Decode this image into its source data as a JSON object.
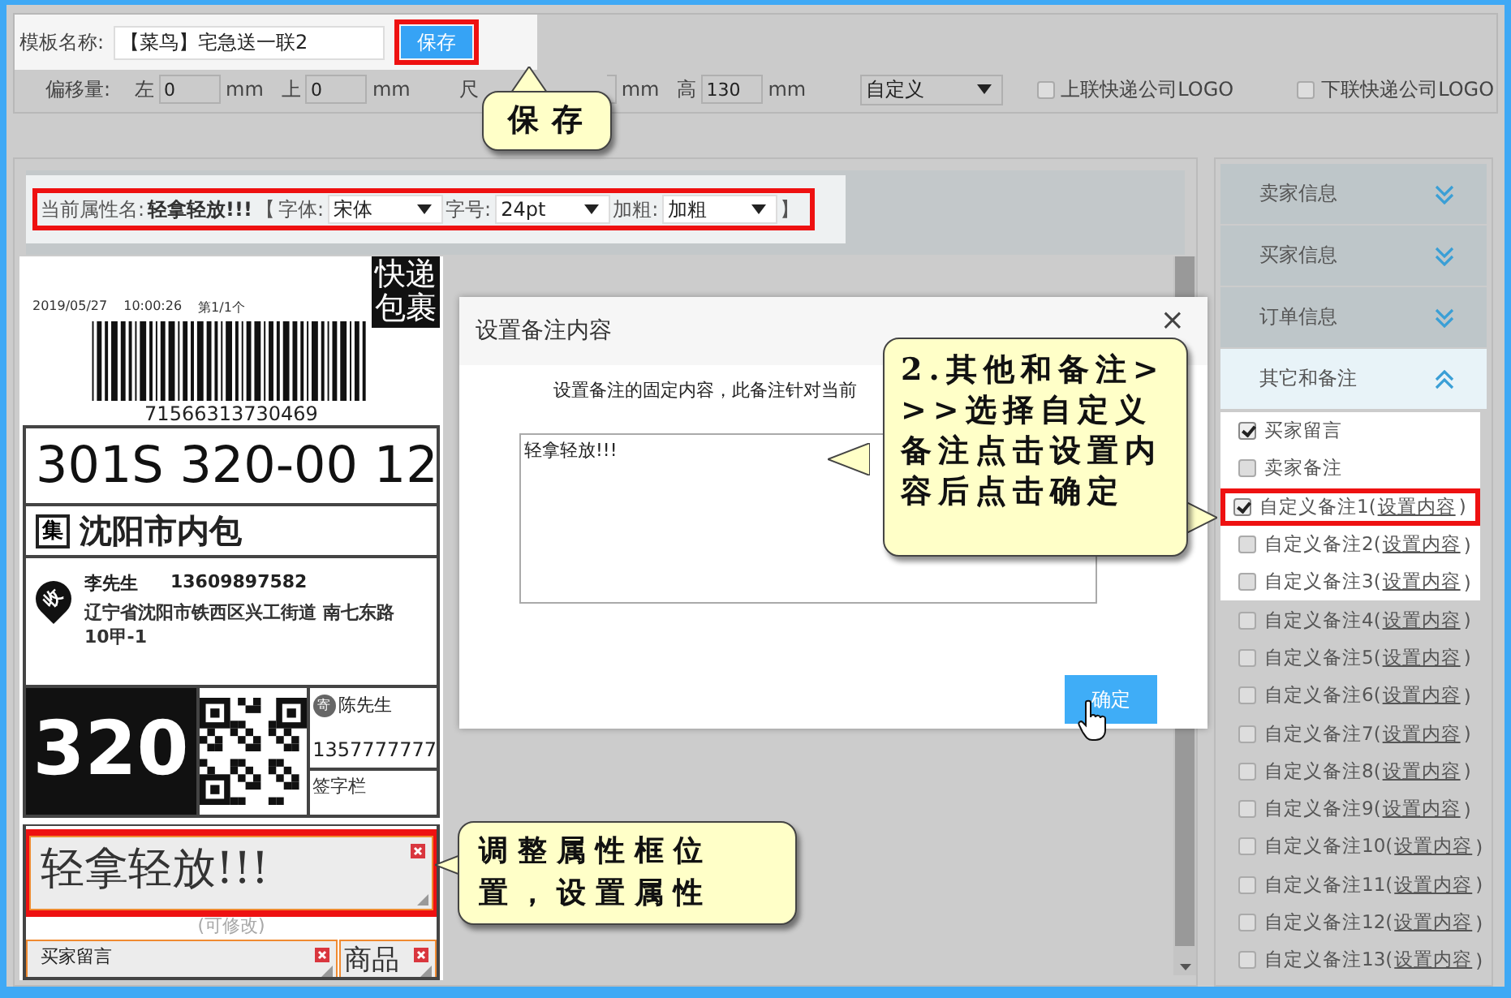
{
  "top_bar": {
    "name_label": "模板名称:",
    "name_value": "【菜鸟】宅急送一联2",
    "save_button": {
      "label": "保存",
      "highlighted": true
    },
    "offset_label": "偏移量:",
    "left_label": "左",
    "left_value": "0",
    "left_unit": "mm",
    "top_label": "上",
    "top_value": "0",
    "top_unit": "mm",
    "size_label": "尺",
    "size_unit": "mm",
    "height_label": "高",
    "height_value": "130",
    "height_unit": "mm",
    "size_preset": "自定义",
    "logo_options": [
      {
        "label": "上联快递公司LOGO",
        "checked": false
      },
      {
        "label": "下联快递公司LOGO",
        "checked": false
      }
    ]
  },
  "property_bar": {
    "highlighted": true,
    "name_label": "当前属性名:",
    "name_value": "轻拿轻放!!!",
    "open_bracket": "【",
    "font_label": "字体:",
    "font_value": "宋体",
    "size_label": "字号:",
    "size_value": "24pt",
    "bold_label": "加粗:",
    "bold_value": "加粗",
    "close_bracket": "】"
  },
  "label_preview": {
    "date": "2019/05/27",
    "time": "10:00:26",
    "page": "第1/1个",
    "badge": "快递包裹",
    "tracking_number": "71566313730469",
    "sort_code": "301S 320-00 12",
    "hub_mark": "集",
    "hub": "沈阳市内包",
    "recipient_mark": "收",
    "recipient_name": "李先生",
    "recipient_phone": "13609897582",
    "recipient_address": "辽宁省沈阳市铁西区兴工街道 南七东路10甲-1",
    "route_code": "320",
    "sender_mark": "寄",
    "sender_name": "陈先生",
    "sender_phone": "1357777777",
    "signature_label": "签字栏",
    "hint": "(可修改)",
    "elements": [
      {
        "kind": "main",
        "text": "轻拿轻放!!!",
        "highlighted": true
      },
      {
        "kind": "small",
        "text": "买家留言",
        "highlighted": false
      },
      {
        "kind": "tall",
        "text": "商品",
        "highlighted": false
      }
    ]
  },
  "dialog": {
    "title": "设置备注内容",
    "close": "×",
    "description": "设置备注的固定内容，此备注针对当前",
    "content": "轻拿轻放!!!",
    "confirm": "确定"
  },
  "sidebar": {
    "sections": [
      {
        "title": "卖家信息",
        "expanded": false
      },
      {
        "title": "买家信息",
        "expanded": false
      },
      {
        "title": "订单信息",
        "expanded": false
      },
      {
        "title": "其它和备注",
        "expanded": true,
        "items": [
          {
            "label": "买家留言",
            "checked": true,
            "spotlight": true,
            "highlighted": false
          },
          {
            "label": "卖家备注",
            "checked": false,
            "spotlight": true,
            "highlighted": false
          },
          {
            "label": "自定义备注1(",
            "link": "设置内容",
            "suffix": ")",
            "checked": true,
            "spotlight": true,
            "highlighted": true
          },
          {
            "label": "自定义备注2(",
            "link": "设置内容",
            "suffix": ")",
            "checked": false,
            "spotlight": true,
            "highlighted": false
          },
          {
            "label": "自定义备注3(",
            "link": "设置内容",
            "suffix": ")",
            "checked": false,
            "spotlight": true,
            "highlighted": false
          },
          {
            "label": "自定义备注4(",
            "link": "设置内容",
            "suffix": ")",
            "checked": false,
            "spotlight": false,
            "highlighted": false
          },
          {
            "label": "自定义备注5(",
            "link": "设置内容",
            "suffix": ")",
            "checked": false,
            "spotlight": false,
            "highlighted": false
          },
          {
            "label": "自定义备注6(",
            "link": "设置内容",
            "suffix": ")",
            "checked": false,
            "spotlight": false,
            "highlighted": false
          },
          {
            "label": "自定义备注7(",
            "link": "设置内容",
            "suffix": ")",
            "checked": false,
            "spotlight": false,
            "highlighted": false
          },
          {
            "label": "自定义备注8(",
            "link": "设置内容",
            "suffix": ")",
            "checked": false,
            "spotlight": false,
            "highlighted": false
          },
          {
            "label": "自定义备注9(",
            "link": "设置内容",
            "suffix": ")",
            "checked": false,
            "spotlight": false,
            "highlighted": false
          },
          {
            "label": "自定义备注10(",
            "link": "设置内容",
            "suffix": ")",
            "checked": false,
            "spotlight": false,
            "highlighted": false
          },
          {
            "label": "自定义备注11(",
            "link": "设置内容",
            "suffix": ")",
            "checked": false,
            "spotlight": false,
            "highlighted": false
          },
          {
            "label": "自定义备注12(",
            "link": "设置内容",
            "suffix": ")",
            "checked": false,
            "spotlight": false,
            "highlighted": false
          },
          {
            "label": "自定义备注13(",
            "link": "设置内容",
            "suffix": ")",
            "checked": false,
            "spotlight": false,
            "highlighted": false
          }
        ]
      }
    ]
  },
  "callouts": [
    {
      "text": "保存",
      "kind": "up"
    },
    {
      "text": "2.其他和备注>>>选择自定义备注点击设置内容后点击确定",
      "kind": "double"
    },
    {
      "text": "调整属性框位置，设置属性",
      "kind": "left"
    }
  ]
}
